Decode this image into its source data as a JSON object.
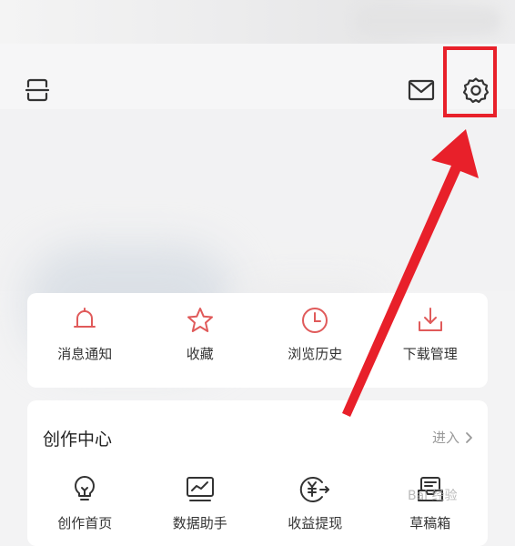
{
  "icons": {
    "scan": "scan-icon",
    "mail": "mail-icon",
    "settings": "gear-icon"
  },
  "quick_actions": [
    {
      "label": "消息通知",
      "icon": "bell-icon"
    },
    {
      "label": "收藏",
      "icon": "star-icon"
    },
    {
      "label": "浏览历史",
      "icon": "clock-icon"
    },
    {
      "label": "下载管理",
      "icon": "download-icon"
    }
  ],
  "creation_center": {
    "title": "创作中心",
    "more_label": "进入",
    "items": [
      {
        "label": "创作首页",
        "icon": "lightbulb-icon"
      },
      {
        "label": "数据助手",
        "icon": "chart-monitor-icon"
      },
      {
        "label": "收益提现",
        "icon": "yuan-withdraw-icon"
      },
      {
        "label": "草稿箱",
        "icon": "draft-box-icon"
      }
    ]
  },
  "watermark": "Bai 经验",
  "colors": {
    "accent_red": "#e8202a",
    "icon_red": "#e05a5a",
    "icon_dark": "#333333"
  }
}
